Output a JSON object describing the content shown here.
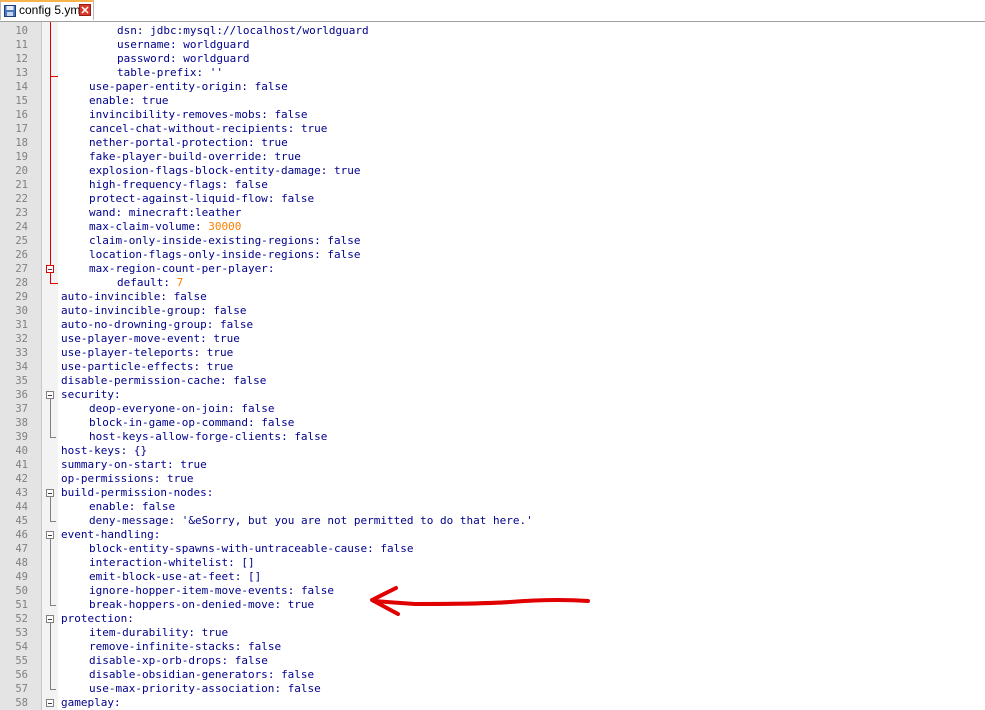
{
  "tab": {
    "title": "config 5.yml",
    "icon": "save-icon",
    "close_icon": "close-icon"
  },
  "colors": {
    "keyword": "#00008b",
    "number": "#ff8000",
    "line_number": "#808080",
    "annotation": "#e00000"
  },
  "lines": [
    {
      "n": "10",
      "indent": 4,
      "key": "dsn",
      "value": "jdbc:mysql://localhost/worldguard",
      "type": "val"
    },
    {
      "n": "11",
      "indent": 4,
      "key": "username",
      "value": "worldguard",
      "type": "val"
    },
    {
      "n": "12",
      "indent": 4,
      "key": "password",
      "value": "worldguard",
      "type": "val"
    },
    {
      "n": "13",
      "indent": 4,
      "key": "table-prefix",
      "value": "''",
      "type": "val"
    },
    {
      "n": "14",
      "indent": 2,
      "key": "use-paper-entity-origin",
      "value": "false",
      "type": "val"
    },
    {
      "n": "15",
      "indent": 2,
      "key": "enable",
      "value": "true",
      "type": "val"
    },
    {
      "n": "16",
      "indent": 2,
      "key": "invincibility-removes-mobs",
      "value": "false",
      "type": "val"
    },
    {
      "n": "17",
      "indent": 2,
      "key": "cancel-chat-without-recipients",
      "value": "true",
      "type": "val"
    },
    {
      "n": "18",
      "indent": 2,
      "key": "nether-portal-protection",
      "value": "true",
      "type": "val"
    },
    {
      "n": "19",
      "indent": 2,
      "key": "fake-player-build-override",
      "value": "true",
      "type": "val"
    },
    {
      "n": "20",
      "indent": 2,
      "key": "explosion-flags-block-entity-damage",
      "value": "true",
      "type": "val"
    },
    {
      "n": "21",
      "indent": 2,
      "key": "high-frequency-flags",
      "value": "false",
      "type": "val"
    },
    {
      "n": "22",
      "indent": 2,
      "key": "protect-against-liquid-flow",
      "value": "false",
      "type": "val"
    },
    {
      "n": "23",
      "indent": 2,
      "key": "wand",
      "value": "minecraft:leather",
      "type": "val"
    },
    {
      "n": "24",
      "indent": 2,
      "key": "max-claim-volume",
      "value": "30000",
      "type": "num"
    },
    {
      "n": "25",
      "indent": 2,
      "key": "claim-only-inside-existing-regions",
      "value": "false",
      "type": "val"
    },
    {
      "n": "26",
      "indent": 2,
      "key": "location-flags-only-inside-regions",
      "value": "false",
      "type": "val"
    },
    {
      "n": "27",
      "indent": 2,
      "key": "max-region-count-per-player",
      "value": "",
      "type": "val"
    },
    {
      "n": "28",
      "indent": 4,
      "key": "default",
      "value": "7",
      "type": "num"
    },
    {
      "n": "29",
      "indent": 0,
      "key": "auto-invincible",
      "value": "false",
      "type": "val"
    },
    {
      "n": "30",
      "indent": 0,
      "key": "auto-invincible-group",
      "value": "false",
      "type": "val"
    },
    {
      "n": "31",
      "indent": 0,
      "key": "auto-no-drowning-group",
      "value": "false",
      "type": "val"
    },
    {
      "n": "32",
      "indent": 0,
      "key": "use-player-move-event",
      "value": "true",
      "type": "val"
    },
    {
      "n": "33",
      "indent": 0,
      "key": "use-player-teleports",
      "value": "true",
      "type": "val"
    },
    {
      "n": "34",
      "indent": 0,
      "key": "use-particle-effects",
      "value": "true",
      "type": "val"
    },
    {
      "n": "35",
      "indent": 0,
      "key": "disable-permission-cache",
      "value": "false",
      "type": "val"
    },
    {
      "n": "36",
      "indent": 0,
      "key": "security",
      "value": "",
      "type": "val"
    },
    {
      "n": "37",
      "indent": 2,
      "key": "deop-everyone-on-join",
      "value": "false",
      "type": "val"
    },
    {
      "n": "38",
      "indent": 2,
      "key": "block-in-game-op-command",
      "value": "false",
      "type": "val"
    },
    {
      "n": "39",
      "indent": 2,
      "key": "host-keys-allow-forge-clients",
      "value": "false",
      "type": "val"
    },
    {
      "n": "40",
      "indent": 0,
      "key": "host-keys",
      "value": "{}",
      "type": "val"
    },
    {
      "n": "41",
      "indent": 0,
      "key": "summary-on-start",
      "value": "true",
      "type": "val"
    },
    {
      "n": "42",
      "indent": 0,
      "key": "op-permissions",
      "value": "true",
      "type": "val"
    },
    {
      "n": "43",
      "indent": 0,
      "key": "build-permission-nodes",
      "value": "",
      "type": "val"
    },
    {
      "n": "44",
      "indent": 2,
      "key": "enable",
      "value": "false",
      "type": "val"
    },
    {
      "n": "45",
      "indent": 2,
      "key": "deny-message",
      "value": "'&eSorry, but you are not permitted to do that here.'",
      "type": "val"
    },
    {
      "n": "46",
      "indent": 0,
      "key": "event-handling",
      "value": "",
      "type": "val"
    },
    {
      "n": "47",
      "indent": 2,
      "key": "block-entity-spawns-with-untraceable-cause",
      "value": "false",
      "type": "val"
    },
    {
      "n": "48",
      "indent": 2,
      "key": "interaction-whitelist",
      "value": "[]",
      "type": "val"
    },
    {
      "n": "49",
      "indent": 2,
      "key": "emit-block-use-at-feet",
      "value": "[]",
      "type": "val"
    },
    {
      "n": "50",
      "indent": 2,
      "key": "ignore-hopper-item-move-events",
      "value": "false",
      "type": "val"
    },
    {
      "n": "51",
      "indent": 2,
      "key": "break-hoppers-on-denied-move",
      "value": "true",
      "type": "val"
    },
    {
      "n": "52",
      "indent": 0,
      "key": "protection",
      "value": "",
      "type": "val"
    },
    {
      "n": "53",
      "indent": 2,
      "key": "item-durability",
      "value": "true",
      "type": "val"
    },
    {
      "n": "54",
      "indent": 2,
      "key": "remove-infinite-stacks",
      "value": "false",
      "type": "val"
    },
    {
      "n": "55",
      "indent": 2,
      "key": "disable-xp-orb-drops",
      "value": "false",
      "type": "val"
    },
    {
      "n": "56",
      "indent": 2,
      "key": "disable-obsidian-generators",
      "value": "false",
      "type": "val"
    },
    {
      "n": "57",
      "indent": 2,
      "key": "use-max-priority-association",
      "value": "false",
      "type": "val"
    },
    {
      "n": "58",
      "indent": 0,
      "key": "gameplay",
      "value": "",
      "type": "val"
    }
  ]
}
